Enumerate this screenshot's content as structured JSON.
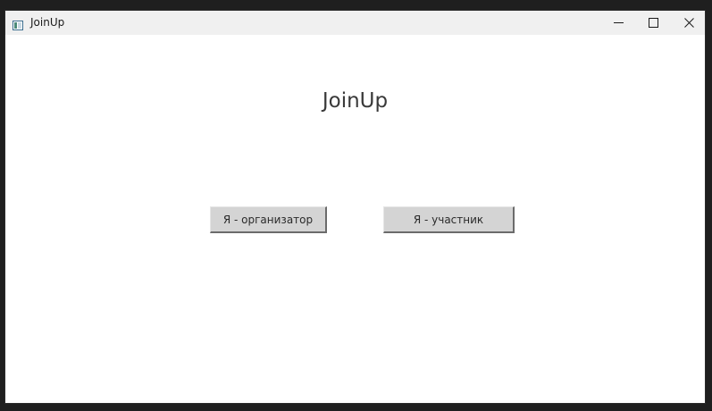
{
  "window": {
    "title": "JoinUp",
    "icon": "app-window-icon",
    "controls": {
      "minimize": "minimize-icon",
      "maximize": "maximize-icon",
      "close": "close-icon"
    }
  },
  "main": {
    "heading": "JoinUp",
    "buttons": {
      "organizer_label": "Я - организатор",
      "participant_label": "Я - участник"
    }
  },
  "colors": {
    "button_bg": "#d4d4d4",
    "titlebar_bg": "#f0f0f0",
    "text": "#3a3a3a"
  }
}
